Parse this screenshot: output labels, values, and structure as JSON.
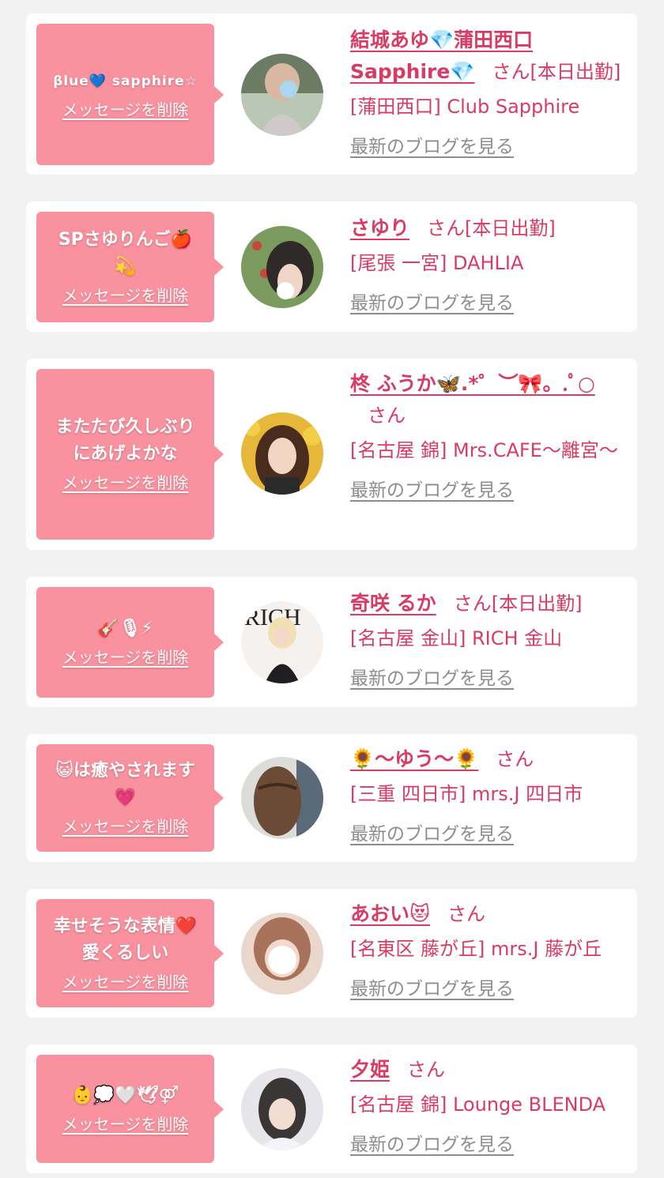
{
  "ui": {
    "delete_label": "メッセージを削除",
    "blog_label": "最新のブログを見る"
  },
  "items": [
    {
      "message": "βlue💙 sapphire☆",
      "name": "結城あゆ💎蒲田西口Sapphire💎",
      "suffix": "さん[本日出勤]",
      "shop": "[蒲田西口] Club Sapphire"
    },
    {
      "message": "SPさゆりんご🍎\n💫",
      "name": "さゆり",
      "suffix": "さん[本日出勤]",
      "shop": "[尾張 一宮] DAHLIA"
    },
    {
      "message": "またたび久しぶり\nにあげよかな",
      "name": "柊 ふうか🦋.*゜︶🎀。.ﾟ○",
      "suffix": "さん",
      "shop": "[名古屋 錦] Mrs.CAFE～離宮～"
    },
    {
      "message": "🎸🎙⚡",
      "name": "奇咲 るか",
      "suffix": "さん[本日出勤]",
      "shop": "[名古屋 金山] RICH 金山"
    },
    {
      "message": "😺は癒やされます\n💗",
      "name": "🌻～ゆう～🌻",
      "suffix": "さん",
      "shop": "[三重 四日市] mrs.J 四日市"
    },
    {
      "message": "幸せそうな表情❤️\n愛くるしい",
      "name": "あおい😻",
      "suffix": "さん",
      "shop": "[名東区 藤が丘] mrs.J 藤が丘"
    },
    {
      "message": "👶💭🤍🕊⚤",
      "name": "夕姫",
      "suffix": "さん",
      "shop": "[名古屋 錦] Lounge BLENDA"
    }
  ]
}
